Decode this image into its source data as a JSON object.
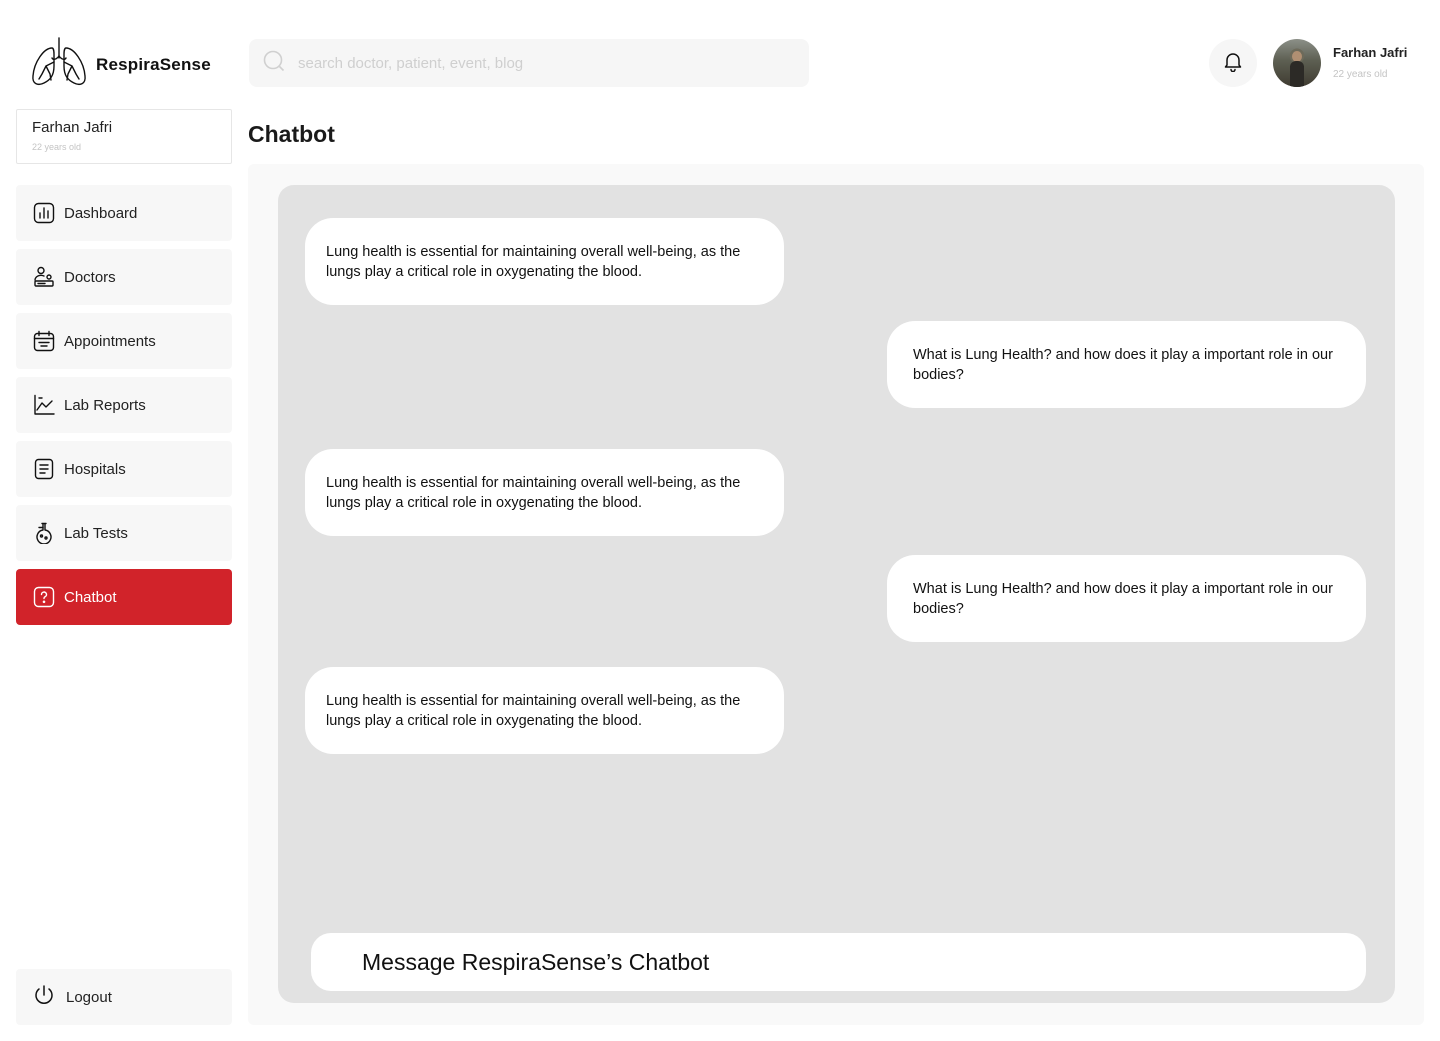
{
  "brand": {
    "name": "RespiraSense",
    "logo_icon": "lungs-icon"
  },
  "search": {
    "placeholder": "search doctor, patient, event, blog",
    "icon": "search-icon"
  },
  "header": {
    "notification_icon": "bell-icon",
    "user": {
      "name": "Farhan Jafri",
      "age": "22 years old"
    }
  },
  "sidebar": {
    "profile": {
      "name": "Farhan Jafri",
      "age": "22 years old"
    },
    "items": [
      {
        "label": "Dashboard",
        "icon": "chart-icon",
        "active": false
      },
      {
        "label": "Doctors",
        "icon": "doctor-icon",
        "active": false
      },
      {
        "label": "Appointments",
        "icon": "calendar-icon",
        "active": false
      },
      {
        "label": "Lab Reports",
        "icon": "line-chart-icon",
        "active": false
      },
      {
        "label": "Hospitals",
        "icon": "document-icon",
        "active": false
      },
      {
        "label": "Lab Tests",
        "icon": "flask-icon",
        "active": false
      },
      {
        "label": "Chatbot",
        "icon": "help-icon",
        "active": true
      }
    ],
    "logout": {
      "label": "Logout",
      "icon": "power-icon"
    }
  },
  "main": {
    "title": "Chatbot",
    "messages": [
      {
        "sender": "bot",
        "text": "Lung health is essential for maintaining overall well-being, as the lungs play a critical role in oxygenating the blood."
      },
      {
        "sender": "user",
        "text": "What is Lung Health? and how does it play a important role in our bodies?"
      },
      {
        "sender": "bot",
        "text": "Lung health is essential for maintaining overall well-being, as the lungs play a critical role in oxygenating the blood."
      },
      {
        "sender": "user",
        "text": "What is Lung Health? and how does it play a important role in our bodies?"
      },
      {
        "sender": "bot",
        "text": "Lung health is essential for maintaining overall well-being, as the lungs play a critical role in oxygenating the blood."
      }
    ],
    "input": {
      "placeholder": "Message RespiraSense’s Chatbot"
    }
  },
  "colors": {
    "accent": "#d1232a",
    "chat_background": "#e2e2e2",
    "panel_background": "#f9f9f9"
  }
}
